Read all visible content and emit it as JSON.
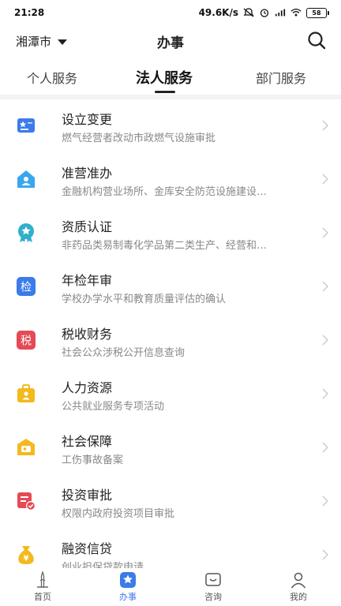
{
  "status_bar": {
    "time": "21:28",
    "speed": "49.6K/s",
    "battery": "58"
  },
  "header": {
    "city": "湘潭市",
    "title": "办事"
  },
  "tabs": [
    "个人服务",
    "法人服务",
    "部门服务"
  ],
  "items": [
    {
      "title": "设立变更",
      "sub": "燃气经营者改动市政燃气设施审批",
      "icon": "star-id-card-icon",
      "color": "#3b7bea"
    },
    {
      "title": "准营准办",
      "sub": "金融机构营业场所、金库安全防范设施建设…",
      "icon": "house-person-icon",
      "color": "#3aa6f0"
    },
    {
      "title": "资质认证",
      "sub": "非药品类易制毒化学品第二类生产、经营和…",
      "icon": "award-badge-icon",
      "color": "#2fb0c9"
    },
    {
      "title": "年检年审",
      "sub": "学校办学水平和教育质量评估的确认",
      "icon": "inspection-icon",
      "color": "#3b7bea"
    },
    {
      "title": "税收财务",
      "sub": "社会公众涉税公开信息查询",
      "icon": "tax-icon",
      "color": "#e54a55"
    },
    {
      "title": "人力资源",
      "sub": "公共就业服务专项活动",
      "icon": "briefcase-person-icon",
      "color": "#f3b91d"
    },
    {
      "title": "社会保障",
      "sub": "工伤事故备案",
      "icon": "shield-card-icon",
      "color": "#f3b91d"
    },
    {
      "title": "投资审批",
      "sub": "权限内政府投资项目审批",
      "icon": "document-check-icon",
      "color": "#e54a55"
    },
    {
      "title": "融资信贷",
      "sub": "创业担保贷款申请",
      "icon": "money-bag-icon",
      "color": "#f3b91d"
    }
  ],
  "icon_glyphs": {
    "inspection": "检",
    "tax": "税",
    "money": "¥"
  },
  "bottom_nav": [
    {
      "label": "首页",
      "icon": "home-pagoda-icon"
    },
    {
      "label": "办事",
      "icon": "star-tab-icon"
    },
    {
      "label": "咨询",
      "icon": "chat-icon"
    },
    {
      "label": "我的",
      "icon": "person-icon"
    }
  ]
}
